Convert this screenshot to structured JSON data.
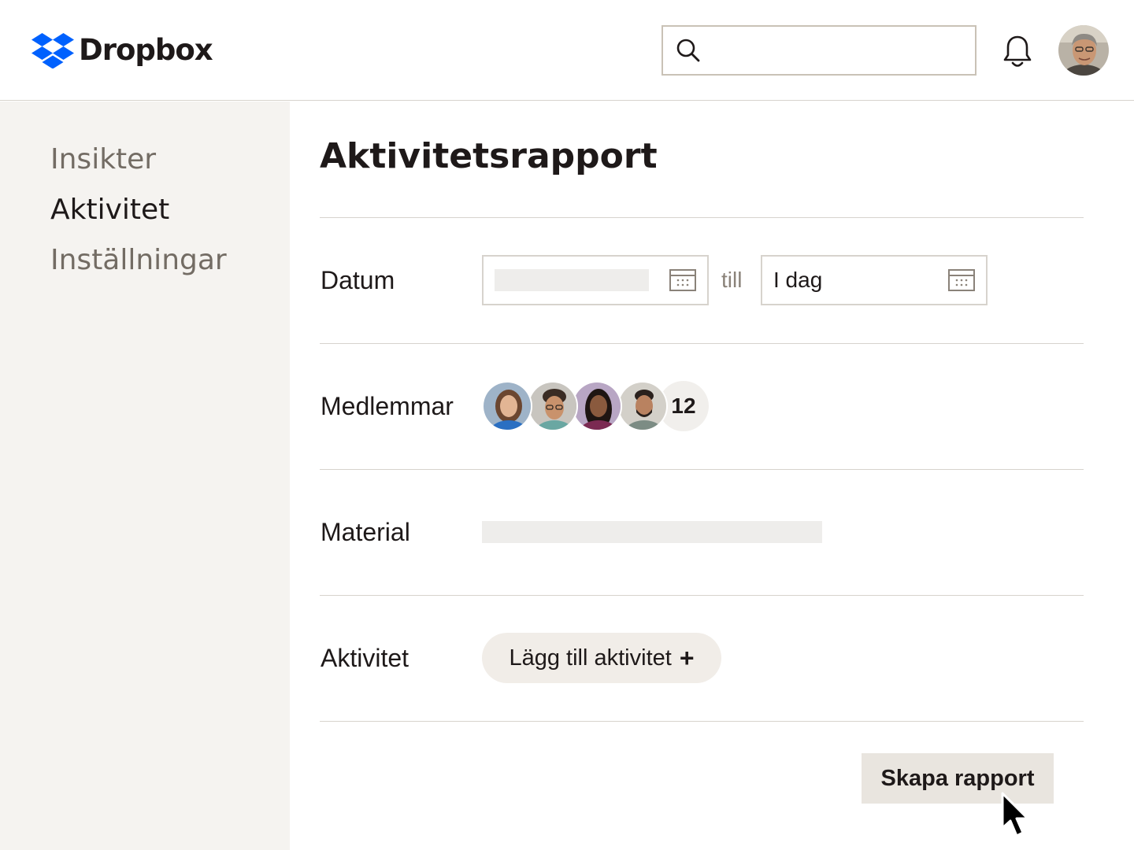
{
  "header": {
    "brand": "Dropbox",
    "search": {
      "value": "",
      "placeholder": ""
    }
  },
  "sidebar": {
    "items": [
      {
        "label": "Insikter",
        "active": false
      },
      {
        "label": "Aktivitet",
        "active": true
      },
      {
        "label": "Inställningar",
        "active": false
      }
    ]
  },
  "main": {
    "title": "Aktivitetsrapport",
    "date": {
      "label": "Datum",
      "from_value": "",
      "separator": "till",
      "to_value": "I dag"
    },
    "members": {
      "label": "Medlemmar",
      "count": "12"
    },
    "material": {
      "label": "Material"
    },
    "activity": {
      "label": "Aktivitet",
      "add_label": "Lägg till aktivitet",
      "add_icon": "+"
    },
    "create_report_label": "Skapa rapport"
  },
  "colors": {
    "brand_blue": "#0061fe",
    "sidebar_bg": "#f5f3f0",
    "text_primary": "#1e1919",
    "text_muted": "#736c64",
    "divider": "#d7d3cd",
    "button_bg": "#e9e5df"
  }
}
